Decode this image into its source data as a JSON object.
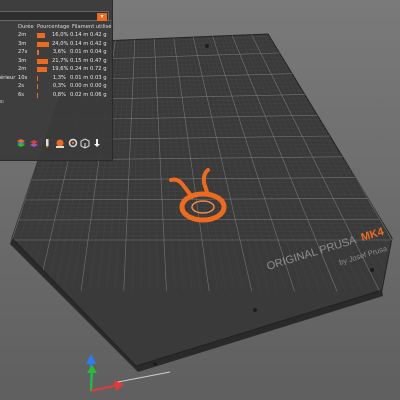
{
  "viewport": {
    "brand": "ORIGINAL PRUSA",
    "model": "MK4",
    "byline": "by Josef Prusa",
    "accent": "#ed6b21"
  },
  "stats_panel": {
    "headers": {
      "duration": "Durée",
      "percentage": "Pourcentage",
      "filament_used": "Filament utilisé"
    },
    "rows": [
      {
        "label": "",
        "duration": "2m",
        "percent": "16,0%",
        "percent_value": 16.0,
        "length": "0.14 m",
        "weight": "0.42 g"
      },
      {
        "label": "",
        "duration": "3m",
        "percent": "24,0%",
        "percent_value": 24.0,
        "length": "0.14 m",
        "weight": "0.42 g"
      },
      {
        "label": "",
        "duration": "27s",
        "percent": "3,6%",
        "percent_value": 3.6,
        "length": "0.01 m",
        "weight": "0.04 g"
      },
      {
        "label": "",
        "duration": "3m",
        "percent": "21,7%",
        "percent_value": 21.7,
        "length": "0.15 m",
        "weight": "0.47 g"
      },
      {
        "label": "",
        "duration": "2m",
        "percent": "19,6%",
        "percent_value": 19.6,
        "length": "0.24 m",
        "weight": "0.72 g"
      },
      {
        "label": "érieur",
        "duration": "10s",
        "percent": "1,3%",
        "percent_value": 1.3,
        "length": "0.01 m",
        "weight": "0.03 g"
      },
      {
        "label": "",
        "duration": "2s",
        "percent": "0,3%",
        "percent_value": 0.3,
        "length": "0.00 m",
        "weight": "0.00 g"
      },
      {
        "label": "",
        "duration": "6s",
        "percent": "0,8%",
        "percent_value": 0.8,
        "length": "0.02 m",
        "weight": "0.06 g"
      }
    ],
    "footer_label": "s:"
  }
}
